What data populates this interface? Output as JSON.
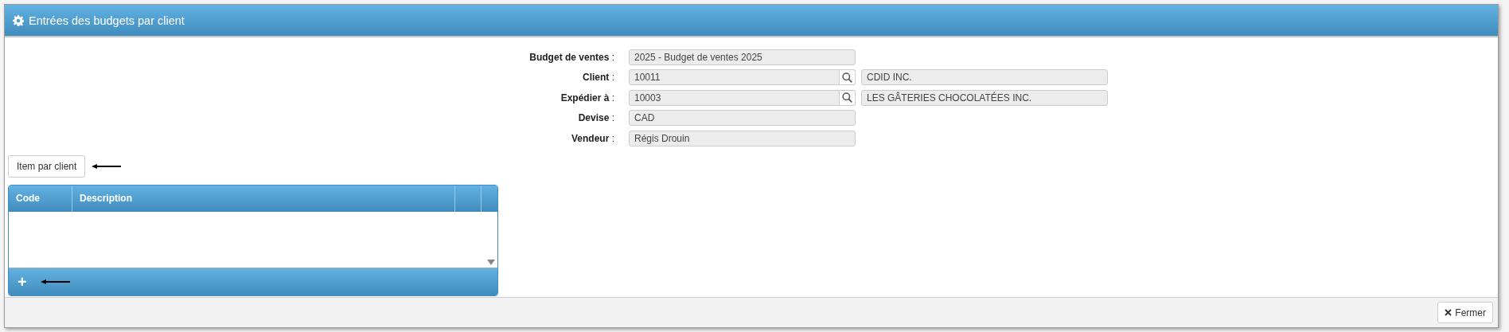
{
  "window": {
    "title": "Entrées des budgets par client"
  },
  "form": {
    "fields": [
      {
        "kind": "text",
        "label": "**Budget de ventes** :",
        "value": "2025 - Budget de ventes 2025"
      },
      {
        "kind": "lookup",
        "label": "**Client** :",
        "value": "10011",
        "name_value": "CDID INC."
      },
      {
        "kind": "lookup",
        "label": "**Expédier à** :",
        "value": "10003",
        "name_value": "LES GÂTERIES CHOCOLATÉES INC."
      },
      {
        "kind": "text",
        "label": "**Devise** :",
        "value": "CAD"
      },
      {
        "kind": "text",
        "label": "**Vendeur** :",
        "value": "Régis Drouin"
      }
    ]
  },
  "item_button": {
    "label": "Item par client"
  },
  "grid": {
    "columns": [
      "Code",
      "Description"
    ],
    "add_button": "+"
  },
  "footer": {
    "close_button": "Fermer"
  }
}
